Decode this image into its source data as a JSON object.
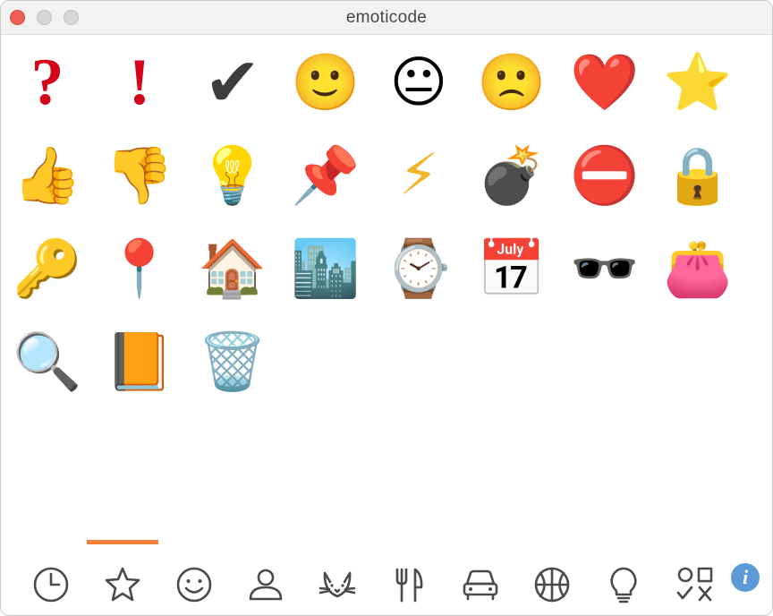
{
  "window": {
    "title": "emoticode"
  },
  "emojis": [
    {
      "name": "question-mark",
      "glyph": "?"
    },
    {
      "name": "exclamation-mark",
      "glyph": "!"
    },
    {
      "name": "check-mark",
      "glyph": "✔"
    },
    {
      "name": "slightly-smiling-face",
      "glyph": "🙂"
    },
    {
      "name": "neutral-face",
      "glyph": "😐"
    },
    {
      "name": "slightly-frowning-face",
      "glyph": "🙁"
    },
    {
      "name": "red-heart",
      "glyph": "❤️"
    },
    {
      "name": "star",
      "glyph": "⭐"
    },
    {
      "name": "thumbs-up",
      "glyph": "👍"
    },
    {
      "name": "thumbs-down",
      "glyph": "👎"
    },
    {
      "name": "light-bulb",
      "glyph": "💡"
    },
    {
      "name": "pushpin",
      "glyph": "📌"
    },
    {
      "name": "lightning",
      "glyph": "⚡"
    },
    {
      "name": "bomb",
      "glyph": "💣"
    },
    {
      "name": "no-entry",
      "glyph": "⛔"
    },
    {
      "name": "lock",
      "glyph": "🔒"
    },
    {
      "name": "key",
      "glyph": "🔑"
    },
    {
      "name": "round-pushpin",
      "glyph": "📍"
    },
    {
      "name": "house",
      "glyph": "🏠"
    },
    {
      "name": "cityscape",
      "glyph": "🏙️"
    },
    {
      "name": "watch",
      "glyph": "⌚"
    },
    {
      "name": "calendar",
      "glyph": "📅"
    },
    {
      "name": "sunglasses",
      "glyph": "🕶️"
    },
    {
      "name": "purse",
      "glyph": "👛"
    },
    {
      "name": "magnifying-glass",
      "glyph": "🔍"
    },
    {
      "name": "book",
      "glyph": "📙"
    },
    {
      "name": "wastebasket",
      "glyph": "🗑️"
    }
  ],
  "tabs": [
    {
      "name": "recent",
      "icon": "clock-icon"
    },
    {
      "name": "favorites",
      "icon": "star-icon",
      "selected": true
    },
    {
      "name": "smileys",
      "icon": "smiley-icon"
    },
    {
      "name": "people",
      "icon": "person-icon"
    },
    {
      "name": "animals",
      "icon": "cat-icon"
    },
    {
      "name": "food",
      "icon": "fork-knife-icon"
    },
    {
      "name": "travel",
      "icon": "car-icon"
    },
    {
      "name": "activities",
      "icon": "basketball-icon"
    },
    {
      "name": "objects",
      "icon": "lightbulb-icon"
    },
    {
      "name": "symbols",
      "icon": "symbols-icon"
    }
  ],
  "info_button": {
    "glyph": "i",
    "color": "#5b9ad6"
  },
  "colors": {
    "accent": "#ef8138",
    "icon_stroke": "#4a4a4a"
  }
}
